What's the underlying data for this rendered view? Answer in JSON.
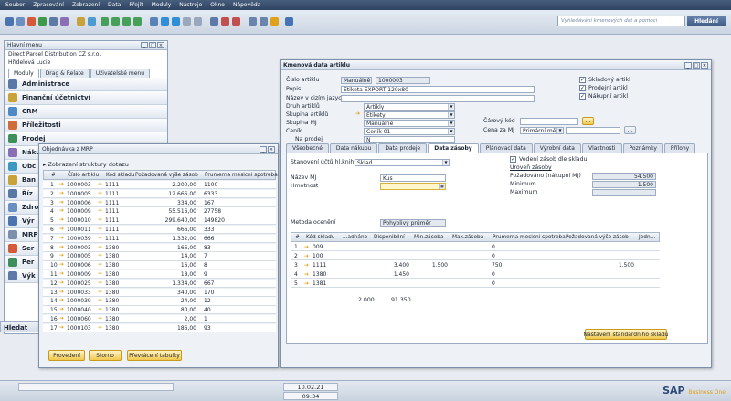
{
  "menubar": [
    "Soubor",
    "Zpracování",
    "Zobrazení",
    "Data",
    "Přejít",
    "Moduly",
    "Nástroje",
    "Okno",
    "Nápověda"
  ],
  "search": {
    "placeholder": "Vyhledávání kmenových dat a pomoci",
    "button": "Hledání"
  },
  "mainmenu": {
    "title": "Hlavní menu",
    "company": "Direct Parcel Distribution CZ s.r.o.",
    "user": "Hřídelová Lucie",
    "tabs": [
      "Moduly",
      "Drag & Relate",
      "Uživatelské menu"
    ],
    "items": [
      "Administrace",
      "Finanční účetnictví",
      "CRM",
      "Příležitosti",
      "Prodej",
      "Náku",
      "Obc",
      "Ban",
      "Říz",
      "Zdro",
      "Výr",
      "MRP",
      "Ser",
      "Per",
      "Výk"
    ],
    "find_label": "Hledat"
  },
  "mrp": {
    "title": "Objednávka z MRP",
    "structure": "Zobrazení struktury dotazu",
    "columns": [
      "#",
      "Číslo artiklu",
      "Kód skladu",
      "Požadovaná výše zásob",
      "Prumerna mesicni spotreba"
    ],
    "rows": [
      [
        "1",
        "1000003",
        "1111",
        "2.200,00",
        "1100"
      ],
      [
        "2",
        "1000005",
        "1111",
        "12.666,00",
        "6333"
      ],
      [
        "3",
        "1000006",
        "1111",
        "334,00",
        "167"
      ],
      [
        "4",
        "1000009",
        "1111",
        "55.516,00",
        "27758"
      ],
      [
        "5",
        "1000010",
        "1111",
        "299.640,00",
        "149820"
      ],
      [
        "6",
        "1000011",
        "1111",
        "666,00",
        "333"
      ],
      [
        "7",
        "1000039",
        "1111",
        "1.332,00",
        "666"
      ],
      [
        "8",
        "1000003",
        "1380",
        "166,00",
        "83"
      ],
      [
        "9",
        "1000005",
        "1380",
        "14,00",
        "7"
      ],
      [
        "10",
        "1000006",
        "1380",
        "16,00",
        "8"
      ],
      [
        "11",
        "1000009",
        "1380",
        "18,00",
        "9"
      ],
      [
        "12",
        "1000025",
        "1380",
        "1.334,00",
        "667"
      ],
      [
        "13",
        "1000033",
        "1380",
        "340,00",
        "170"
      ],
      [
        "14",
        "1000039",
        "1380",
        "24,00",
        "12"
      ],
      [
        "15",
        "1000040",
        "1380",
        "80,00",
        "40"
      ],
      [
        "16",
        "1000060",
        "1380",
        "2,00",
        "1"
      ],
      [
        "17",
        "1000103",
        "1380",
        "186,00",
        "93"
      ]
    ],
    "buttons": [
      "Provedení",
      "Storno",
      "Převrácení tabulky"
    ]
  },
  "item": {
    "title": "Kmenová data artiklu",
    "labels": {
      "cislo": "Číslo artiklu",
      "popis": "Popis",
      "nazev_cizi": "Název v cizím jazyce",
      "druh": "Druh artiklů",
      "skupina": "Skupina artiklů",
      "skupina_mj": "Skupina MJ",
      "cenik": "Ceník",
      "na_prodej": "Na prodej",
      "carovy": "Čárový kód",
      "cena_za_mj": "Cena za MJ"
    },
    "values": {
      "cislo_mode": "Manuálně",
      "cislo": "1000003",
      "popis": "Etiketa EXPORT 120x80",
      "druh": "Artikly",
      "skupina": "Etikety",
      "skupina_mj": "Manuálně",
      "cenik": "Ceník 01",
      "na_prodej": "N",
      "cena_mena": "Primární měna"
    },
    "checks": [
      "Skladový artikl",
      "Prodejní artikl",
      "Nákupní artikl"
    ],
    "tabs": [
      "Všeobecné",
      "Data nákupu",
      "Data prodeje",
      "Data zásoby",
      "Plánovací data",
      "Výrobní data",
      "Vlastnosti",
      "Poznámky",
      "Přílohy"
    ],
    "panel": {
      "stanoveni_label": "Stanovení účtů hl.knihy dle",
      "stanoveni_value": "Sklad",
      "vedeni_label": "Vedení zásob dle skladu",
      "uroven": "Úroveň zásoby",
      "pozadovano_label": "Požadováno (nákupní MJ)",
      "pozadovano": "54.500",
      "minimum_label": "Minimum",
      "minimum": "1.500",
      "maximum_label": "Maximum",
      "nazev_mj_label": "Název MJ",
      "nazev_mj": "Kus",
      "hmotnost_label": "Hmotnost",
      "metoda_label": "Metoda ocenění",
      "metoda": "Pohyblivý průměr",
      "columns": [
        "#",
        "Kód skladu",
        "...adnáno",
        "Disponibilní",
        "Min.zásoba",
        "Max.zásoba",
        "Prumerna mesicni spotreba",
        "Požadovaná výše zásob",
        "Jedn..."
      ],
      "rows": [
        [
          "1",
          "009",
          "",
          "",
          "",
          "",
          "0",
          "",
          ""
        ],
        [
          "2",
          "100",
          "",
          "",
          "",
          "",
          "0",
          "",
          ""
        ],
        [
          "3",
          "1111",
          "",
          "3.400",
          "1.500",
          "",
          "750",
          "1.500",
          ""
        ],
        [
          "4",
          "1380",
          "",
          "1.450",
          "",
          "",
          "0",
          "",
          ""
        ],
        [
          "5",
          "1381",
          "",
          "",
          "",
          "",
          "0",
          "",
          ""
        ]
      ],
      "totals": [
        "2.000",
        "91.350"
      ],
      "std_button": "Nastavení standardního skladu"
    }
  },
  "status": {
    "date": "10.02.21",
    "time": "09:34",
    "logo": "SAP",
    "logo_sub": "Business One"
  }
}
